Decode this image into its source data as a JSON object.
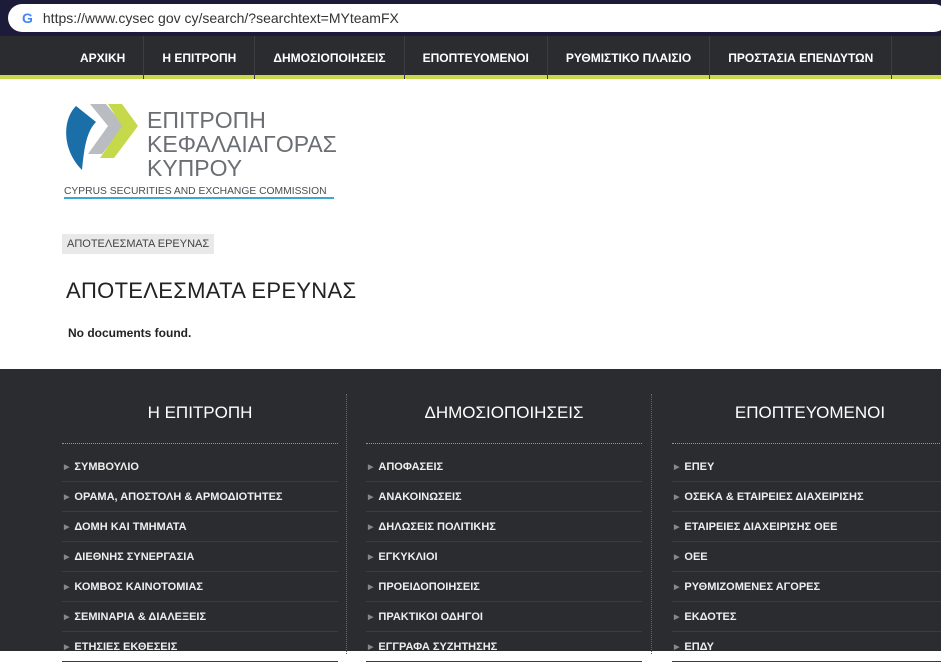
{
  "browser": {
    "url": "https://www.cysec gov cy/search/?searchtext=MYteamFX"
  },
  "nav": [
    "ΑΡΧΙΚΗ",
    "Η ΕΠΙΤΡΟΠΗ",
    "ΔΗΜΟΣΙΟΠΟΙΗΣΕΙΣ",
    "ΕΠΟΠΤΕΥΟΜΕΝΟΙ",
    "ΡΥΘΜΙΣΤΙΚΟ ΠΛΑΙΣΙΟ",
    "ΠΡΟΣΤΑΣΙΑ ΕΠΕΝΔΥΤΩΝ"
  ],
  "logo": {
    "line1": "ΕΠΙΤΡΟΠΗ",
    "line2": "ΚΕΦΑΛΑΙΑΓΟΡΑΣ",
    "line3": "ΚΥΠΡΟΥ",
    "sub": "CYPRUS SECURITIES AND EXCHANGE COMMISSION"
  },
  "breadcrumb": "ΑΠΟΤΕΛΕΣΜΑΤΑ ΕΡΕΥΝΑΣ",
  "page_title": "ΑΠΟΤΕΛΕΣΜΑΤΑ ΕΡΕΥΝΑΣ",
  "message": "No documents found.",
  "colors": {
    "nav_bg": "#2b2c30",
    "accent": "#c6d94a"
  },
  "footer": [
    {
      "title": "Η ΕΠΙΤΡΟΠΗ",
      "items": [
        "ΣΥΜΒΟΥΛΙΟ",
        "ΟΡΑΜΑ, ΑΠΟΣΤΟΛΗ & ΑΡΜΟΔΙΟΤΗΤΕΣ",
        "ΔΟΜΗ ΚΑΙ ΤΜΗΜΑΤΑ",
        "ΔΙΕΘΝΗΣ ΣΥΝΕΡΓΑΣΙΑ",
        "ΚΟΜΒΟΣ ΚΑΙΝΟΤΟΜΙΑΣ",
        "ΣΕΜΙΝΑΡΙΑ & ΔΙΑΛΕΞΕΙΣ",
        "ΕΤΗΣΙΕΣ ΕΚΘΕΣΕΙΣ"
      ]
    },
    {
      "title": "ΔΗΜΟΣΙΟΠΟΙΗΣΕΙΣ",
      "items": [
        "ΑΠΟΦΑΣΕΙΣ",
        "ΑΝΑΚΟΙΝΩΣΕΙΣ",
        "ΔΗΛΩΣΕΙΣ ΠΟΛΙΤΙΚΗΣ",
        "ΕΓΚΥΚΛΙΟΙ",
        "ΠΡΟΕΙΔΟΠΟΙΗΣΕΙΣ",
        "ΠΡΑΚΤΙΚΟΙ ΟΔΗΓΟΙ",
        "ΕΓΓΡΑΦΑ ΣΥΖΗΤΗΣΗΣ"
      ]
    },
    {
      "title": "ΕΠΟΠΤΕΥΟΜΕΝΟΙ",
      "items": [
        "ΕΠΕΥ",
        "ΟΣΕΚΑ & ΕΤΑΙΡΕΙΕΣ ΔΙΑΧΕΙΡΙΣΗΣ",
        "ΕΤΑΙΡΕΙΕΣ ΔΙΑΧΕΙΡΙΣΗΣ ΟΕΕ",
        "ΟΕΕ",
        "ΡΥΘΜΙΖΟΜΕΝΕΣ ΑΓΟΡΕΣ",
        "ΕΚΔΟΤΕΣ",
        "ΕΠΔΥ"
      ]
    }
  ]
}
